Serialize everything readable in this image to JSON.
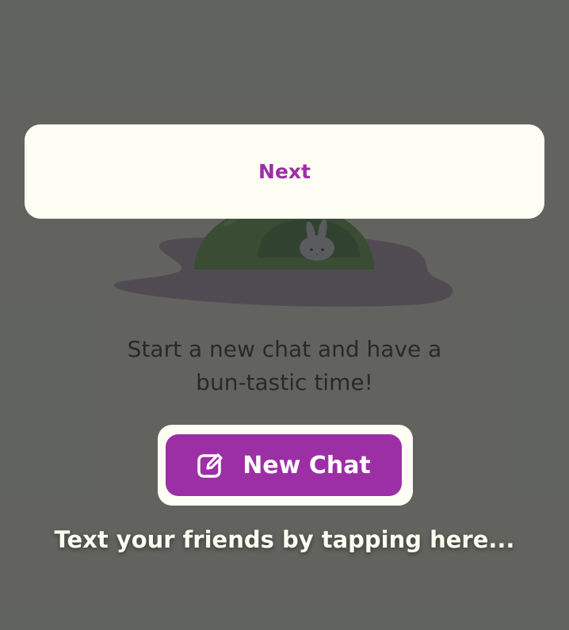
{
  "empty_state": {
    "line1": "Start a new chat and have a",
    "line2": "bun-tastic time!"
  },
  "new_chat_button": {
    "label": "New Chat",
    "icon": "compose-icon"
  },
  "coach_hint": "Text your friends by tapping here...",
  "next_button": {
    "label": "Next"
  },
  "colors": {
    "accent": "#9c2fa6",
    "card": "#fdfdf4",
    "scrim": "rgba(40, 42, 40, 0.72)"
  }
}
